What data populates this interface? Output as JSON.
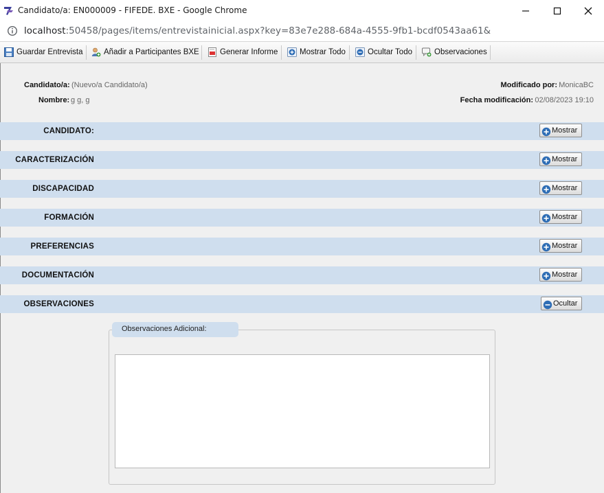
{
  "window": {
    "title": "Candidato/a: EN000009 - FIFEDE. BXE - Google Chrome",
    "url_host": "localhost",
    "url_rest": ":50458/pages/items/entrevistainicial.aspx?key=83e7e288-684a-4555-9fb1-bcdf0543aa61&"
  },
  "toolbar": {
    "guardar": "Guardar Entrevista",
    "anadir": "Añadir a Participantes BXE",
    "generar": "Generar Informe",
    "mostrar_todo": "Mostrar Todo",
    "ocultar_todo": "Ocultar Todo",
    "observaciones": "Observaciones"
  },
  "header": {
    "candidato_label": "Candidato/a:",
    "candidato_value": "(Nuevo/a Candidato/a)",
    "nombre_label": "Nombre:",
    "nombre_value": "g g, g",
    "modificado_label": "Modificado por:",
    "modificado_value": "MonicaBC",
    "fecha_label": "Fecha modificación:",
    "fecha_value": "02/08/2023 19:10"
  },
  "sections": [
    {
      "title": "CANDIDATO:",
      "button": "Mostrar",
      "icon": "plus-icon"
    },
    {
      "title": "CARACTERIZACIÓN",
      "button": "Mostrar",
      "icon": "plus-icon"
    },
    {
      "title": "DISCAPACIDAD",
      "button": "Mostrar",
      "icon": "plus-icon"
    },
    {
      "title": "FORMACIÓN",
      "button": "Mostrar",
      "icon": "plus-icon"
    },
    {
      "title": "PREFERENCIAS",
      "button": "Mostrar",
      "icon": "plus-icon"
    },
    {
      "title": "DOCUMENTACIÓN",
      "button": "Mostrar",
      "icon": "plus-icon"
    },
    {
      "title": "OBSERVACIONES",
      "button": "Ocultar",
      "icon": "minus-icon"
    }
  ],
  "observaciones": {
    "legend": "Observaciones Adicional:",
    "value": ""
  },
  "colors": {
    "band": "#cfdeee",
    "icon_blue": "#2e6db5"
  }
}
